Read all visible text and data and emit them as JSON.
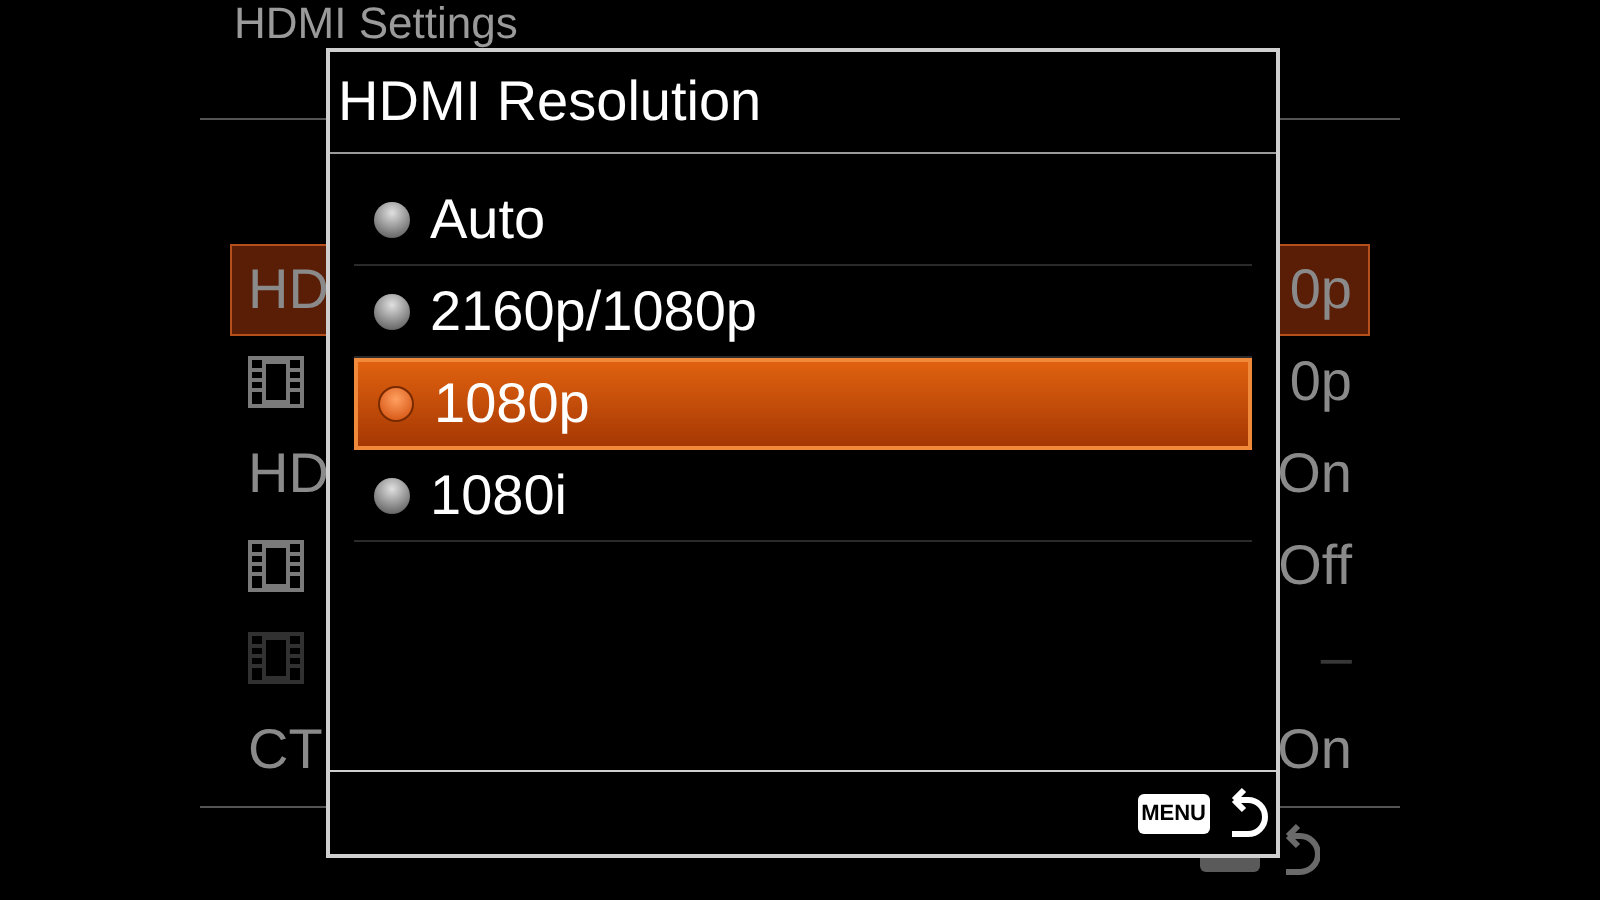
{
  "background_menu": {
    "title": "HDMI Settings",
    "rows": [
      {
        "kind": "text",
        "label": "HD",
        "value": "0p",
        "selected": true,
        "disabled": false
      },
      {
        "kind": "film",
        "value": "0p",
        "selected": false,
        "disabled": false
      },
      {
        "kind": "text",
        "label": "HD",
        "value": "On",
        "selected": false,
        "disabled": false
      },
      {
        "kind": "film",
        "value": "Off",
        "selected": false,
        "disabled": false
      },
      {
        "kind": "film",
        "value": "–",
        "selected": false,
        "disabled": true
      },
      {
        "kind": "text",
        "label": "CT",
        "value": "On",
        "selected": false,
        "disabled": false
      }
    ]
  },
  "dialog": {
    "title": "HDMI Resolution",
    "options": [
      {
        "label": "Auto",
        "selected": false
      },
      {
        "label": "2160p/1080p",
        "selected": false
      },
      {
        "label": "1080p",
        "selected": true
      },
      {
        "label": "1080i",
        "selected": false
      }
    ],
    "back_key": "MENU"
  }
}
